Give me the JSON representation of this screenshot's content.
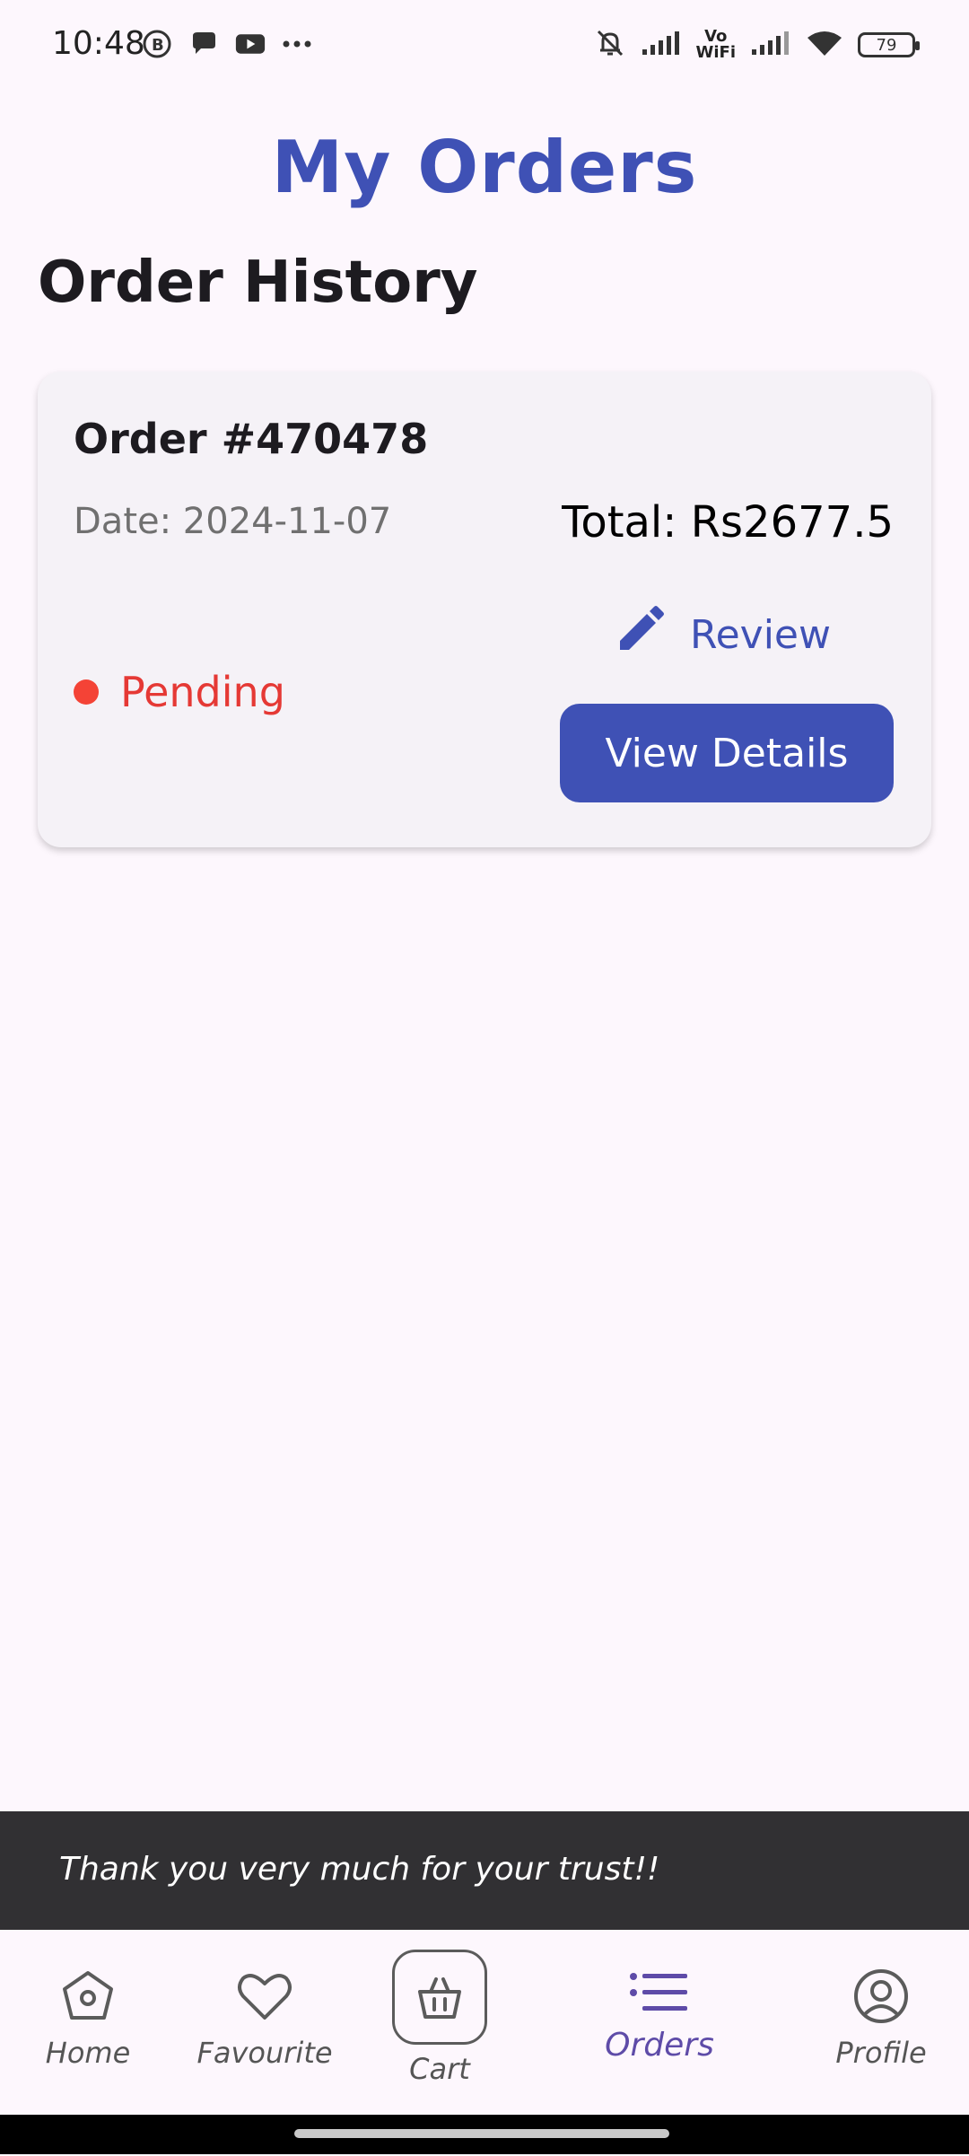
{
  "status_bar": {
    "time": "10:48",
    "left_icons": [
      "b-circle-icon",
      "chat-bubble-icon",
      "youtube-icon",
      "more-dots-icon"
    ],
    "right_icons": [
      "bell-muted-icon",
      "signal-icon",
      "vowifi-icon",
      "signal-icon",
      "wifi-icon",
      "battery-icon"
    ],
    "vowifi_top": "Vo",
    "vowifi_bottom": "WiFi",
    "battery": "79"
  },
  "header": {
    "title": "My Orders"
  },
  "section": {
    "title": "Order History"
  },
  "orders": [
    {
      "order_no": "Order #470478",
      "date": "Date: 2024-11-07",
      "total": "Total: Rs2677.5",
      "review_label": "Review",
      "status": "Pending",
      "view_details_label": "View Details"
    }
  ],
  "snackbar": {
    "message": "Thank you very much for your trust!!"
  },
  "bottom_nav": {
    "items": [
      {
        "label": "Home",
        "icon": "home-icon"
      },
      {
        "label": "Favourite",
        "icon": "heart-icon"
      },
      {
        "label": "Cart",
        "icon": "basket-icon"
      },
      {
        "label": "Orders",
        "icon": "list-icon",
        "active": true
      },
      {
        "label": "Profile",
        "icon": "user-circle-icon"
      }
    ]
  },
  "colors": {
    "accent": "#3F51B5",
    "status_pending": "#E53935",
    "background": "#FDF7FD",
    "snackbar": "#313033"
  }
}
